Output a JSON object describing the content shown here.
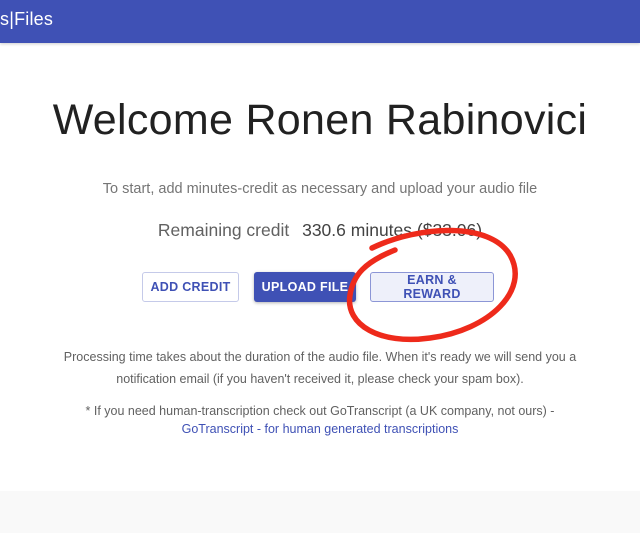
{
  "header": {
    "title": "s|Files",
    "color": "#3f51b5"
  },
  "main": {
    "welcome": "Welcome Ronen Rabinovici",
    "instruction": "To start, add minutes-credit as necessary and upload your audio file",
    "credit_label": "Remaining credit",
    "credit_value": "330.6 minutes ($33.06)",
    "buttons": {
      "add_credit": "ADD CREDIT",
      "upload_file": "UPLOAD FILE",
      "earn_reward": "EARN & REWARD"
    },
    "processing_note": "Processing time takes about the duration of the audio file. When it's ready we will send you a notification email (if you haven't received it, please check your spam box).",
    "human_note": "* If you need human-transcription check out GoTranscript (a UK company, not ours) -",
    "human_link": "GoTranscript - for human generated transcriptions"
  },
  "annotation": {
    "shape": "ellipse",
    "color": "#ee2a1b",
    "target": "EARN & REWARD"
  }
}
